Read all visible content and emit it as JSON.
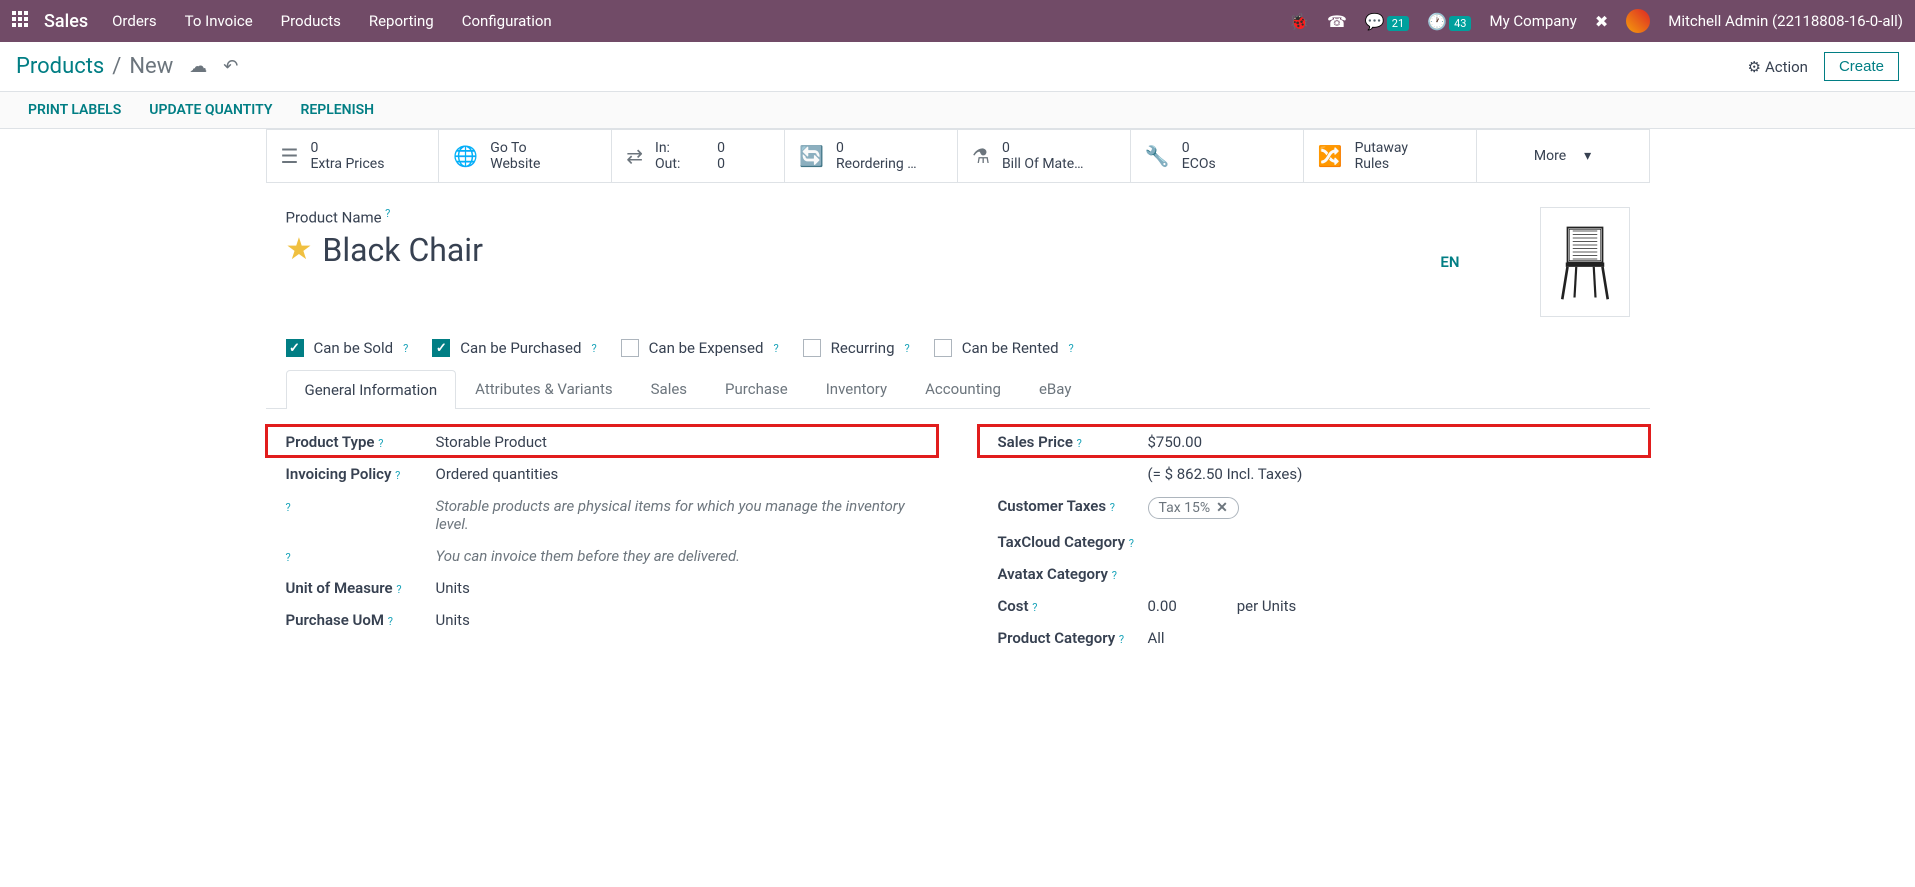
{
  "topbar": {
    "app_name": "Sales",
    "menu": [
      "Orders",
      "To Invoice",
      "Products",
      "Reporting",
      "Configuration"
    ],
    "msg_count": "21",
    "activity_count": "43",
    "company": "My Company",
    "user": "Mitchell Admin (22118808-16-0-all)"
  },
  "control_panel": {
    "breadcrumb_root": "Products",
    "breadcrumb_current": "New",
    "action_label": "Action",
    "create_label": "Create"
  },
  "sub_actions": {
    "print_labels": "PRINT LABELS",
    "update_quantity": "UPDATE QUANTITY",
    "replenish": "REPLENISH"
  },
  "stat_buttons": {
    "extra_prices": {
      "value": "0",
      "label": "Extra Prices"
    },
    "go_to_website": {
      "line1": "Go To",
      "line2": "Website"
    },
    "in_out": {
      "in_label": "In:",
      "in_value": "0",
      "out_label": "Out:",
      "out_value": "0"
    },
    "reordering": {
      "value": "0",
      "label": "Reordering …"
    },
    "bom": {
      "value": "0",
      "label": "Bill Of Mate…"
    },
    "ecos": {
      "value": "0",
      "label": "ECOs"
    },
    "putaway": {
      "line1": "Putaway",
      "line2": "Rules"
    },
    "more": "More"
  },
  "product": {
    "name_label": "Product Name",
    "name": "Black Chair",
    "lang": "EN"
  },
  "checkboxes": {
    "can_be_sold": {
      "label": "Can be Sold",
      "checked": true
    },
    "can_be_purchased": {
      "label": "Can be Purchased",
      "checked": true
    },
    "can_be_expensed": {
      "label": "Can be Expensed",
      "checked": false
    },
    "recurring": {
      "label": "Recurring",
      "checked": false
    },
    "can_be_rented": {
      "label": "Can be Rented",
      "checked": false
    }
  },
  "tabs": [
    "General Information",
    "Attributes & Variants",
    "Sales",
    "Purchase",
    "Inventory",
    "Accounting",
    "eBay"
  ],
  "form": {
    "left": {
      "product_type": {
        "label": "Product Type",
        "value": "Storable Product"
      },
      "invoicing_policy": {
        "label": "Invoicing Policy",
        "value": "Ordered quantities"
      },
      "help1": "Storable products are physical items for which you manage the inventory level.",
      "help2": "You can invoice them before they are delivered.",
      "uom": {
        "label": "Unit of Measure",
        "value": "Units"
      },
      "purchase_uom": {
        "label": "Purchase UoM",
        "value": "Units"
      }
    },
    "right": {
      "sales_price": {
        "label": "Sales Price",
        "value": "$750.00",
        "incl": "(= $ 862.50 Incl. Taxes)"
      },
      "customer_taxes": {
        "label": "Customer Taxes",
        "tag": "Tax 15%"
      },
      "taxcloud": {
        "label": "TaxCloud Category"
      },
      "avatax": {
        "label": "Avatax Category"
      },
      "cost": {
        "label": "Cost",
        "value": "0.00",
        "per": "per Units"
      },
      "product_category": {
        "label": "Product Category",
        "value": "All"
      }
    }
  },
  "help_mark": "?"
}
